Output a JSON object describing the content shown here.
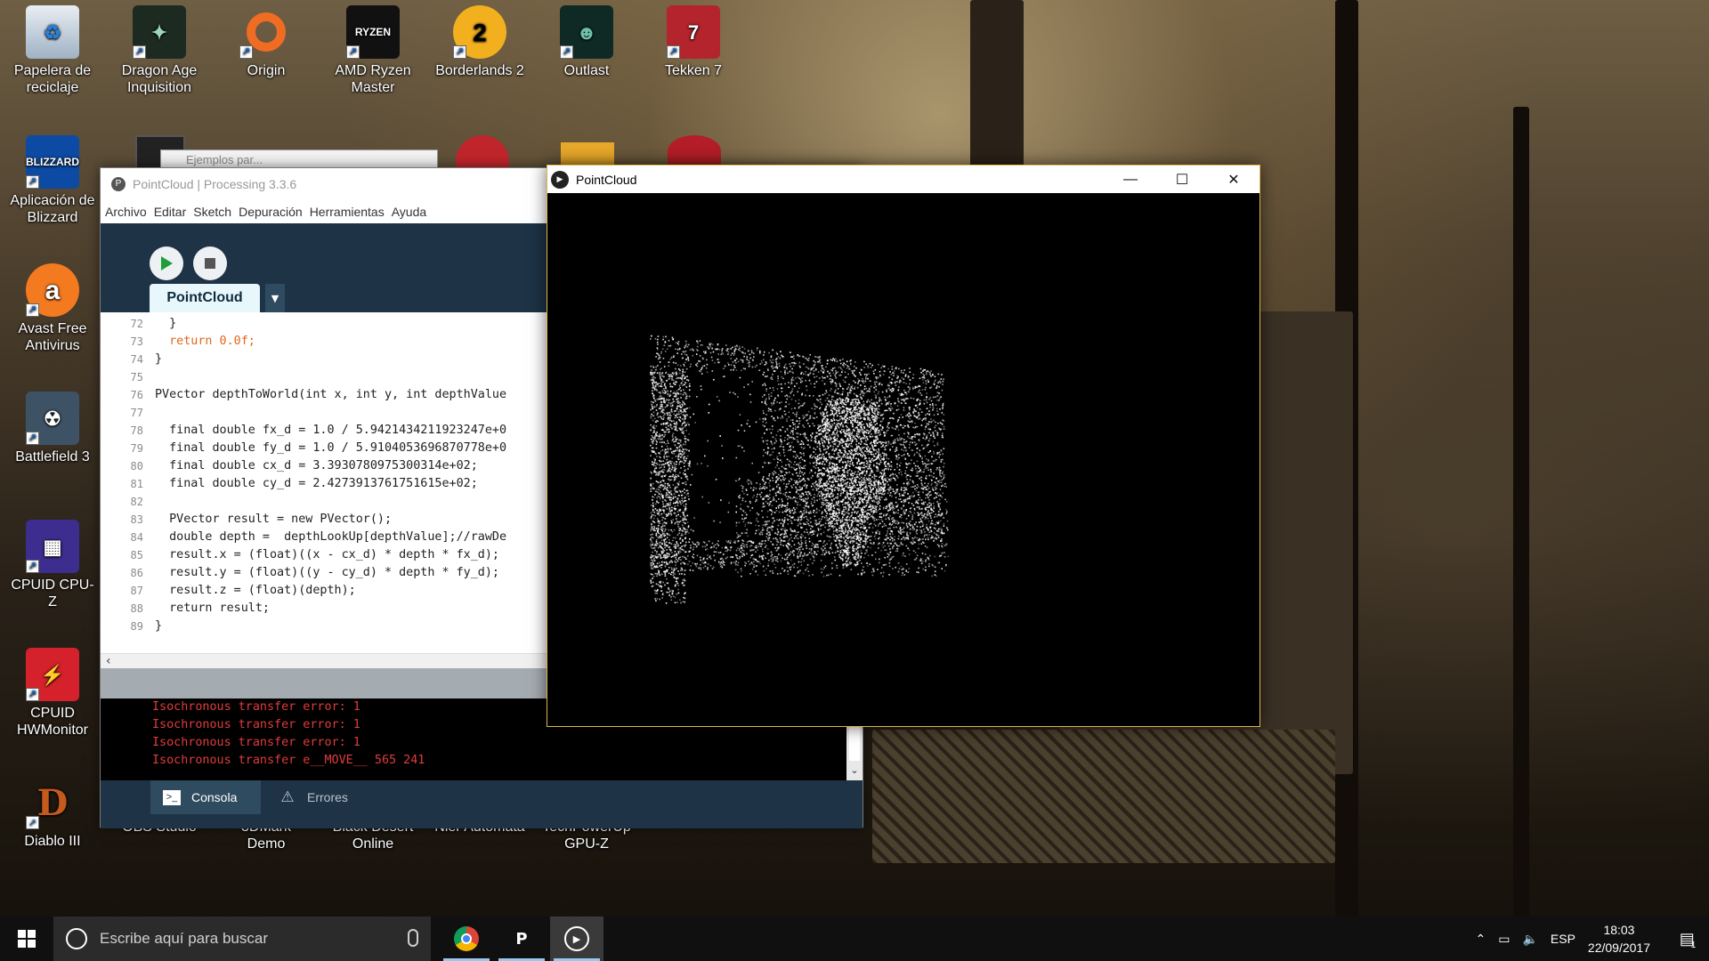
{
  "desktop_icons": [
    {
      "label": "Papelera de reciclaje"
    },
    {
      "label": "Dragon Age Inquisition"
    },
    {
      "label": "Origin"
    },
    {
      "label": "AMD Ryzen Master"
    },
    {
      "label": "Borderlands 2"
    },
    {
      "label": "Outlast"
    },
    {
      "label": "Tekken 7"
    },
    {
      "label": "Aplicación de Blizzard"
    },
    {
      "label": "Avast Free Antivirus"
    },
    {
      "label": "Battlefield 3"
    },
    {
      "label": "CPUID CPU-Z"
    },
    {
      "label": "CPUID HWMonitor"
    },
    {
      "label": "Diablo III"
    },
    {
      "label": "OBS Studio"
    },
    {
      "label": "3DMark Demo"
    },
    {
      "label": "Black Desert Online"
    },
    {
      "label": "Nier Automata"
    },
    {
      "label": "TechPowerUp GPU-Z"
    }
  ],
  "bg_window_title": "Ejemplos par...",
  "ide": {
    "title": "PointCloud | Processing 3.3.6",
    "menu": [
      "Archivo",
      "Editar",
      "Sketch",
      "Depuración",
      "Herramientas",
      "Ayuda"
    ],
    "tab": "PointCloud",
    "code": [
      {
        "n": "72",
        "t": "  }"
      },
      {
        "n": "73",
        "t": "  return 0.0f;"
      },
      {
        "n": "74",
        "t": "}"
      },
      {
        "n": "75",
        "t": ""
      },
      {
        "n": "76",
        "t": "PVector depthToWorld(int x, int y, int depthValue"
      },
      {
        "n": "77",
        "t": ""
      },
      {
        "n": "78",
        "t": "  final double fx_d = 1.0 / 5.9421434211923247e+0"
      },
      {
        "n": "79",
        "t": "  final double fy_d = 1.0 / 5.9104053696870778e+0"
      },
      {
        "n": "80",
        "t": "  final double cx_d = 3.3930780975300314e+02;"
      },
      {
        "n": "81",
        "t": "  final double cy_d = 2.4273913761751615e+02;"
      },
      {
        "n": "82",
        "t": ""
      },
      {
        "n": "83",
        "t": "  PVector result = new PVector();"
      },
      {
        "n": "84",
        "t": "  double depth =  depthLookUp[depthValue];//rawDe"
      },
      {
        "n": "85",
        "t": "  result.x = (float)((x - cx_d) * depth * fx_d);"
      },
      {
        "n": "86",
        "t": "  result.y = (float)((y - cy_d) * depth * fy_d);"
      },
      {
        "n": "87",
        "t": "  result.z = (float)(depth);"
      },
      {
        "n": "88",
        "t": "  return result;"
      },
      {
        "n": "89",
        "t": "}"
      }
    ],
    "console": [
      "Isochronous transfer error: 1",
      "Isochronous transfer error: 1",
      "Isochronous transfer error: 1",
      "Isochronous transfer e__MOVE__ 565 241"
    ],
    "console_tab": "Consola",
    "errors_tab": "Errores"
  },
  "sketch": {
    "title": "PointCloud"
  },
  "taskbar": {
    "search_placeholder": "Escribe aquí para buscar",
    "language": "ESP",
    "time": "18:03",
    "date": "22/09/2017",
    "notifications": "1"
  },
  "colors": {
    "processing_dark": "#1e3346",
    "console_error": "#e13c3c",
    "sketch_border": "#e0b54a"
  }
}
